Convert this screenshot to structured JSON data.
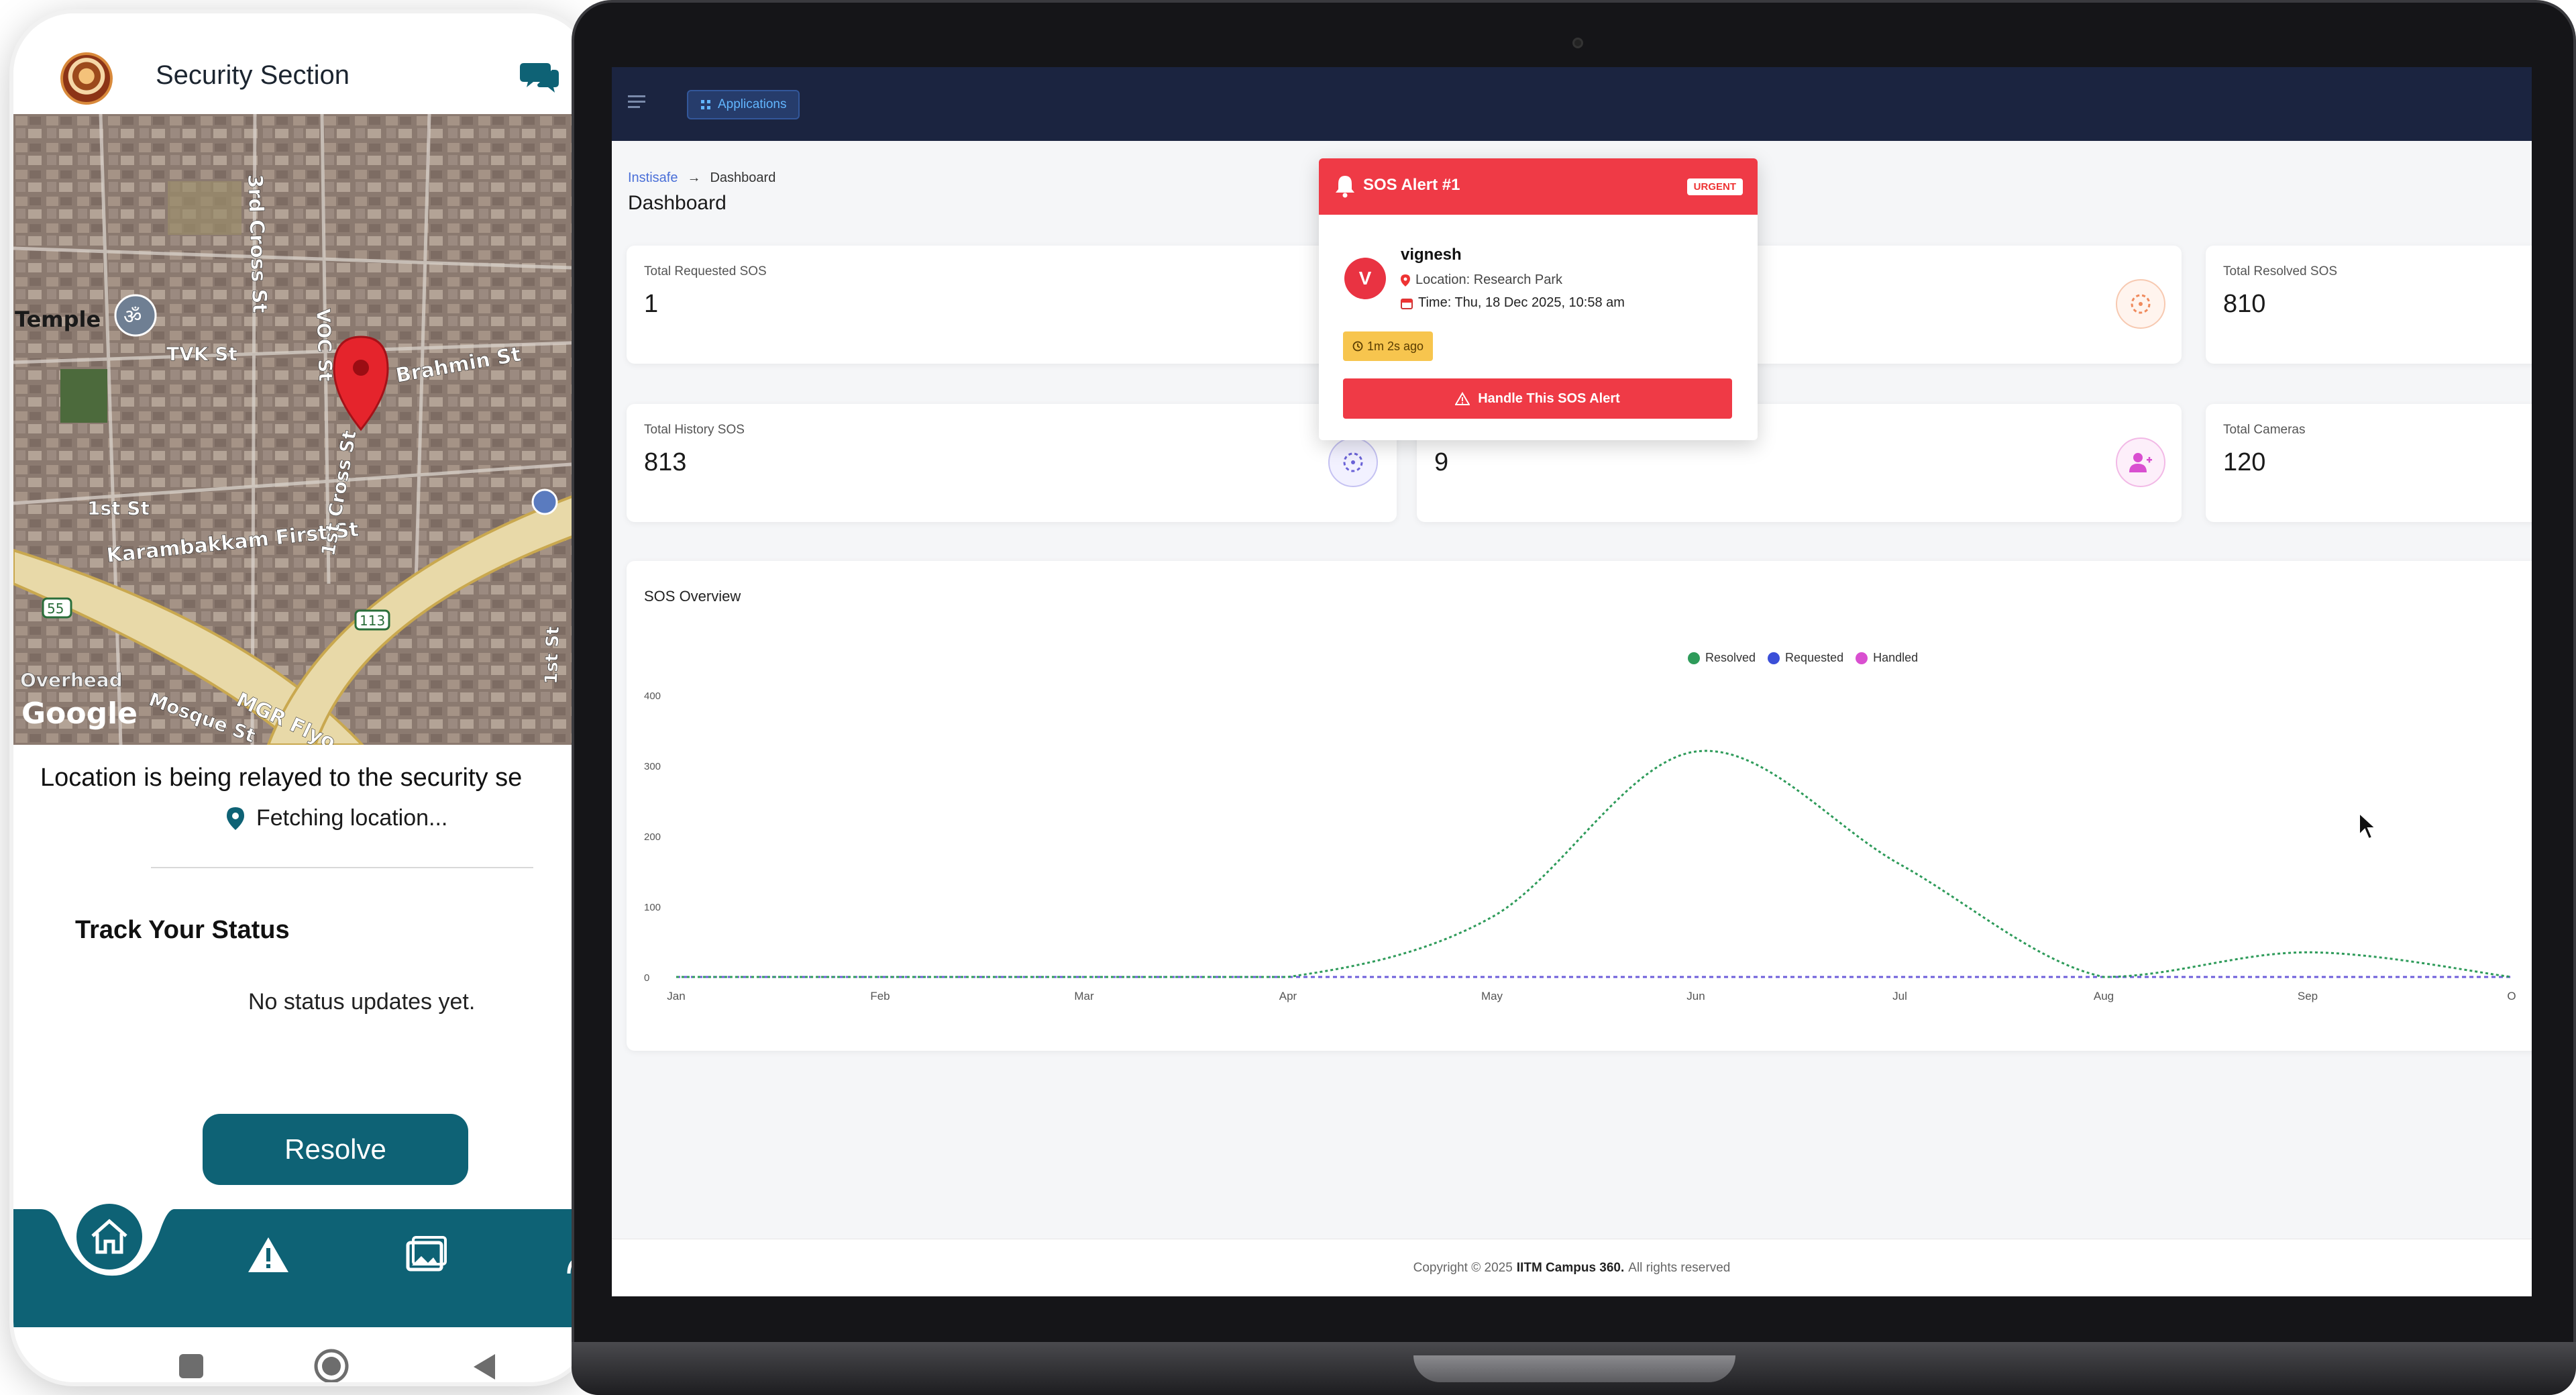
{
  "phone": {
    "header_title": "Security Section",
    "map": {
      "labels": [
        "3rd Cross St",
        "VOC St",
        "Temple",
        "TVK St",
        "Brahmin St",
        "1st St",
        "Karambakkam First St",
        "1st Cross St",
        "55",
        "113",
        "Overhead",
        "Mosque St",
        "MGR Flyo",
        "1st St",
        "Google"
      ]
    },
    "relay_text": "Location is being relayed to the security se",
    "fetching_text": "Fetching location...",
    "track_title": "Track Your Status",
    "no_status": "No status updates yet.",
    "resolve_label": "Resolve",
    "nav_icons": [
      "home-icon",
      "alert-icon",
      "gallery-icon",
      "profile-icon"
    ]
  },
  "dashboard": {
    "apps_label": "Applications",
    "breadcrumb": {
      "root": "Instisafe",
      "sep": "→",
      "current": "Dashboard"
    },
    "page_title": "Dashboard",
    "cards": [
      {
        "label": "Total Requested SOS",
        "value": "1"
      },
      {
        "label": "Total Resolved SOS",
        "value": "810"
      },
      {
        "label": "Total History SOS",
        "value": "813"
      },
      {
        "label": "",
        "value": "9"
      },
      {
        "label": "Total Cameras",
        "value": "120"
      }
    ],
    "chart_title": "SOS Overview",
    "footer": {
      "prefix": "Copyright © 2025",
      "brand": "IITM Campus 360.",
      "suffix": "All rights reserved"
    }
  },
  "sos_alert": {
    "title": "SOS Alert #1",
    "badge": "URGENT",
    "avatar_letter": "V",
    "name": "vignesh",
    "location": "Location: Research Park",
    "time": "Time: Thu, 18 Dec 2025, 10:58 am",
    "ago": "1m 2s ago",
    "action": "Handle This SOS Alert"
  },
  "colors": {
    "teal": "#0e6275",
    "navy": "#1b2440",
    "sos_red": "#ef3a46",
    "resolved": "#2e9b5a",
    "requested": "#3b4fd8",
    "handled": "#d94fd0"
  },
  "chart_data": {
    "type": "line",
    "x": [
      "Jan",
      "Feb",
      "Mar",
      "Apr",
      "May",
      "Jun",
      "Jul",
      "Aug",
      "Sep",
      "O"
    ],
    "series": [
      {
        "name": "Resolved",
        "values": [
          0,
          0,
          0,
          0,
          85,
          320,
          160,
          0,
          35,
          0
        ]
      },
      {
        "name": "Requested",
        "values": [
          0,
          0,
          0,
          0,
          0,
          0,
          0,
          0,
          0,
          0
        ]
      },
      {
        "name": "Handled",
        "values": [
          0,
          0,
          0,
          0,
          0,
          0,
          0,
          0,
          0,
          0
        ]
      }
    ],
    "y_ticks": [
      "400",
      "300",
      "200",
      "100",
      "0"
    ],
    "ylim": [
      0,
      400
    ],
    "legend_position": "top-center",
    "grid": false
  }
}
